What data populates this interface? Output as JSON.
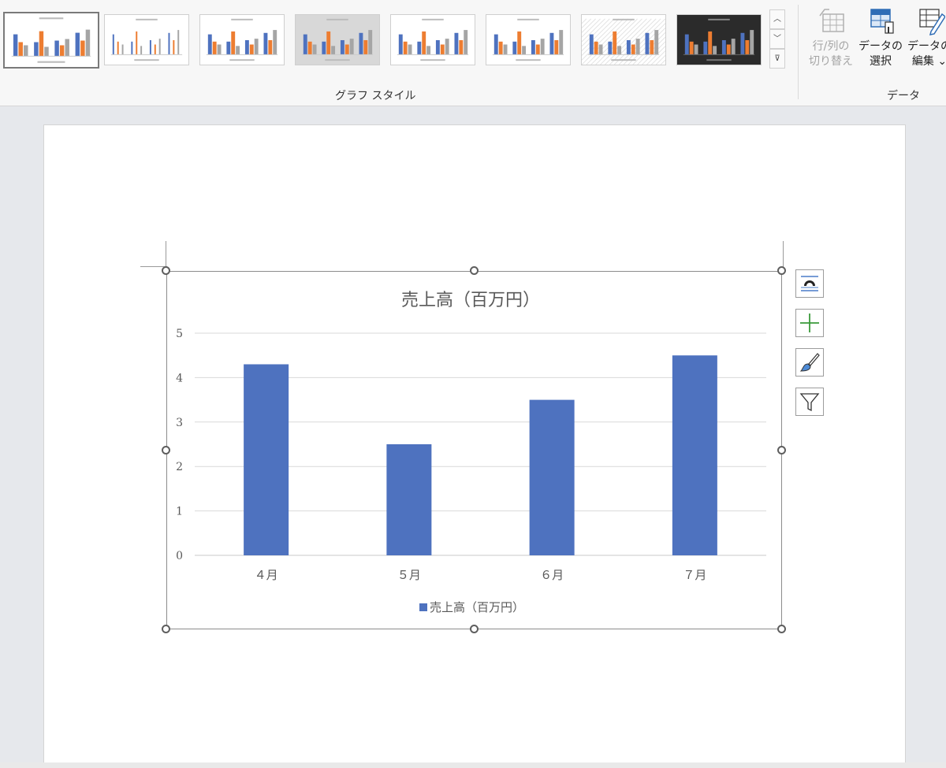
{
  "ribbon": {
    "chart_styles_group_label": "グラフ スタイル",
    "data_group_label": "データ",
    "switch_row_col": {
      "line1": "行/列の",
      "line2": "切り替え"
    },
    "select_data": {
      "line1": "データの",
      "line2": "選択"
    },
    "edit_data": {
      "line1": "データの",
      "line2": "編集 ⌄"
    },
    "gallery_scroll": {
      "up": "︿",
      "down": "﹀",
      "more": "⊽"
    }
  },
  "chart_data": {
    "type": "bar",
    "title": "売上高（百万円）",
    "categories": [
      "４月",
      "５月",
      "６月",
      "７月"
    ],
    "series": [
      {
        "name": "売上高（百万円）",
        "values": [
          4.3,
          2.5,
          3.5,
          4.5
        ],
        "color": "#4e72bf"
      }
    ],
    "ylim": [
      0,
      5
    ],
    "yticks": [
      "0",
      "1",
      "2",
      "3",
      "4",
      "5"
    ],
    "grid": true,
    "legend": "bottom"
  },
  "side_tools": [
    "layout-options-icon",
    "chart-elements-icon",
    "chart-styles-icon",
    "chart-filters-icon"
  ],
  "colors": {
    "bar_blue": "#4e72bf",
    "orange": "#ed7d31",
    "gray": "#a5a5a5"
  }
}
